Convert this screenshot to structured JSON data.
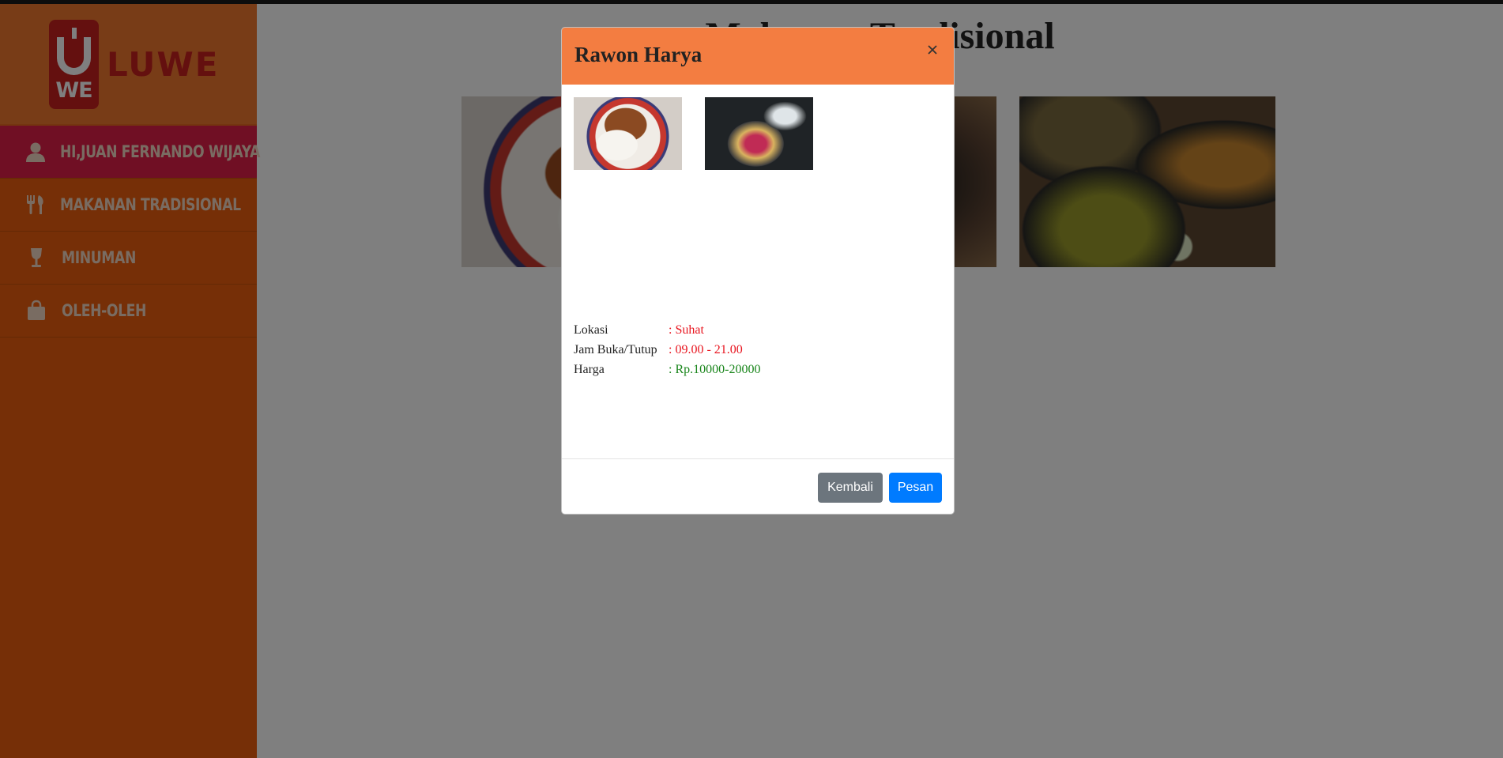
{
  "brand": {
    "logo_letter": "U",
    "logo_sub": "WE",
    "logo_text": "LUWE"
  },
  "sidebar": {
    "items": [
      {
        "label": "Hi,Juan Fernando Wijaya",
        "icon": "user-icon"
      },
      {
        "label": "Makanan Tradisional",
        "icon": "utensils-icon"
      },
      {
        "label": "Minuman",
        "icon": "wine-glass-icon"
      },
      {
        "label": "Oleh-Oleh",
        "icon": "shopping-bag-icon"
      }
    ]
  },
  "main": {
    "title": "Makanan Tradisional"
  },
  "modal": {
    "title": "Rawon Harya",
    "close_label": "×",
    "info": [
      {
        "label": "Lokasi",
        "value": ": Suhat"
      },
      {
        "label": "Jam Buka/Tutup",
        "value": ": 09.00 - 21.00"
      },
      {
        "label": "Harga",
        "value": ": Rp.10000-20000"
      }
    ],
    "buttons": {
      "back_label": "Kembali",
      "order_label": "Pesan"
    }
  },
  "colors": {
    "sidebar": "#ec5f0f",
    "active_item": "#e01f48",
    "modal_header": "#f37d41",
    "highlight_red": "#e8141e",
    "price_green": "#18851a",
    "button_secondary": "#6c757d",
    "button_primary": "#007bff"
  }
}
